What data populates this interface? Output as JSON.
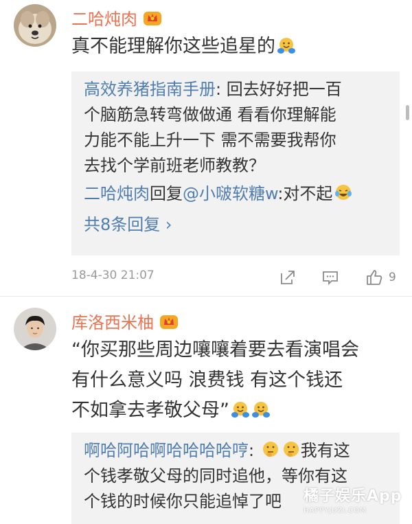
{
  "comments": [
    {
      "username": "二哈炖肉",
      "text": "真不能理解你这些追星的",
      "reply_box": {
        "author": "高效养猪指南手册",
        "text_lines": [
          ": 回去好好把一百",
          "个脑筋急转弯做做通 看看你理解能",
          "力能不能上升一下 需不需要我帮你",
          "去找个学前班老师教教？"
        ],
        "reply_author": "二哈炖肉",
        "reply_verb": "回复",
        "reply_target": "@小啵软糖w",
        "reply_text": ":对不起",
        "more_replies": "共8条回复 ›"
      },
      "timestamp": "18-4-30 21:07",
      "likes": "9"
    },
    {
      "username": "库洛西米柚",
      "text_lines": [
        "“你买那些周边嚷嚷着要去看演唱会",
        "有什么意义吗 浪费钱 有这个钱还",
        "不如拿去孝敬父母”"
      ],
      "reply_box": {
        "author": "啊哈阿哈啊哈哈哈哈哼",
        "text_lines": [
          ": ",
          "我有这",
          "个钱孝敬父母的同时追他，等你有这",
          "个钱的时候你只能追悼了吧"
        ]
      }
    }
  ],
  "watermark": {
    "title": "橘子娱乐App",
    "subtitle": "HAPPYJUZI.COM"
  },
  "colors": {
    "username": "#eb7350",
    "link": "#507daf",
    "reply_bg": "#f2f2f2"
  },
  "icons": [
    "share-icon",
    "comment-icon",
    "like-icon",
    "vip-crown-icon",
    "hugging-emoji",
    "laughing-crying-emoji",
    "thinking-emoji"
  ]
}
